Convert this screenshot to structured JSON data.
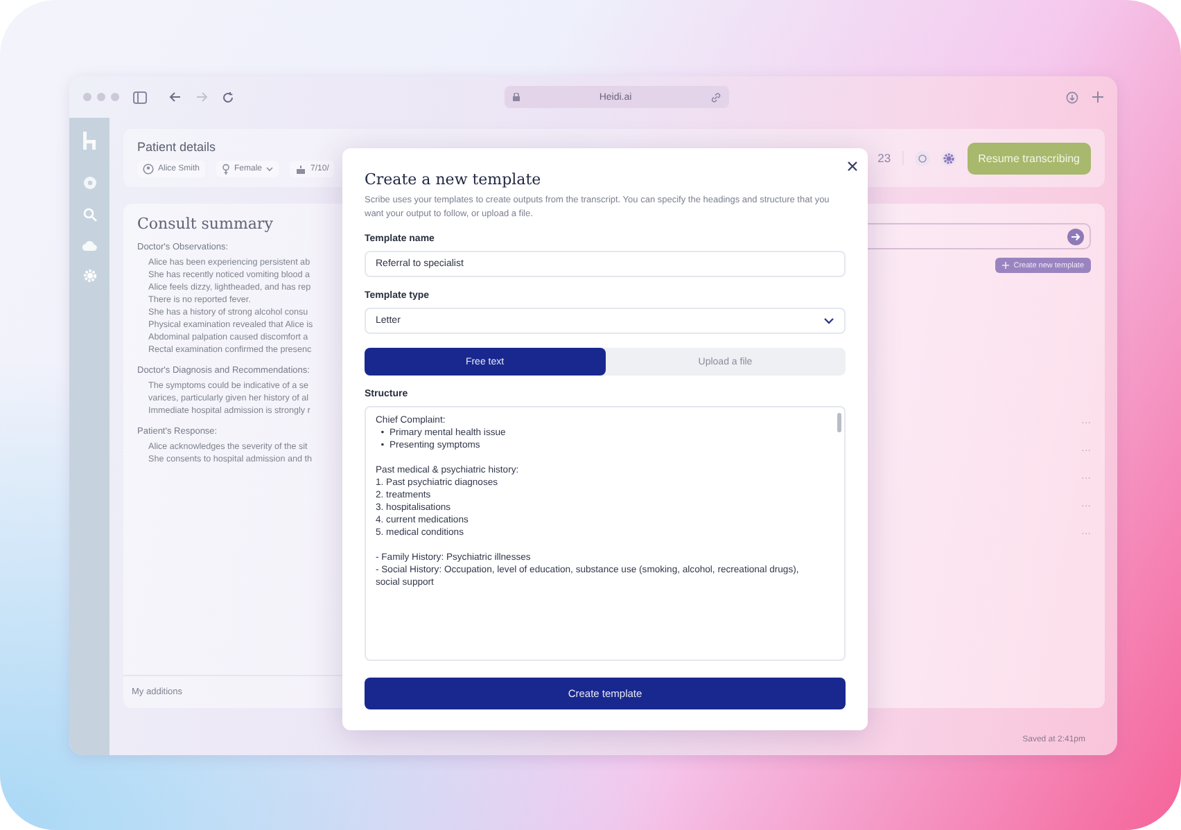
{
  "browser": {
    "address": "Heidi.ai"
  },
  "header": {
    "title": "Patient details",
    "chips": [
      {
        "kind": "person",
        "label": "Alice Smith",
        "dropdown": false
      },
      {
        "kind": "gender",
        "label": "Female",
        "dropdown": true
      },
      {
        "kind": "birth",
        "label": "7/10/",
        "dropdown": false
      }
    ],
    "time": "23",
    "action": "Resume transcribing"
  },
  "summary": {
    "title": "Consult summary",
    "sections": [
      {
        "heading": "Doctor's Observations:",
        "items": [
          "Alice has been experiencing persistent ab",
          "She has recently noticed vomiting blood a",
          "Alice feels dizzy, lightheaded, and has rep",
          "There is no reported fever.",
          "She has a history of strong alcohol consu",
          "Physical examination revealed that Alice is",
          "Abdominal palpation caused discomfort a",
          "Rectal examination confirmed the presenc"
        ]
      },
      {
        "heading": "Doctor's Diagnosis and Recommendations:",
        "items": [
          "The symptoms could be indicative of a se\nvarices, particularly given her history of al",
          "Immediate hospital admission is strongly r"
        ]
      },
      {
        "heading": "Patient's Response:",
        "items": [
          "Alice acknowledges the severity of the sit\nShe consents to hospital admission and th"
        ]
      }
    ],
    "additions": "My additions"
  },
  "templates": {
    "create_button": "Create new template",
    "row_menus": [
      "···",
      "···",
      "···",
      "···",
      "···"
    ]
  },
  "status_bar": "Saved at 2:41pm",
  "modal": {
    "title": "Create a new template",
    "description": "Scribe uses your templates to create outputs from the transcript. You can specify the headings and structure that you want your output to follow, or upload a file.",
    "fields": [
      {
        "kind": "text",
        "label": "Template name",
        "value": "Referral to specialist"
      },
      {
        "kind": "select",
        "label": "Template type",
        "value": "Letter"
      }
    ],
    "tabs": [
      {
        "label": "Free text",
        "selected": true
      },
      {
        "label": "Upload a file",
        "selected": false
      }
    ],
    "structure": {
      "label": "Structure",
      "value": "Chief Complaint:\n  •  Primary mental health issue\n  •  Presenting symptoms\n\nPast medical & psychiatric history:\n1. Past psychiatric diagnoses\n2. treatments\n3. hospitalisations\n4. current medications\n5. medical conditions\n\n- Family History: Psychiatric illnesses\n- Social History: Occupation, level of education, substance use (smoking, alcohol, recreational drugs), social support"
    },
    "submit": "Create template"
  }
}
